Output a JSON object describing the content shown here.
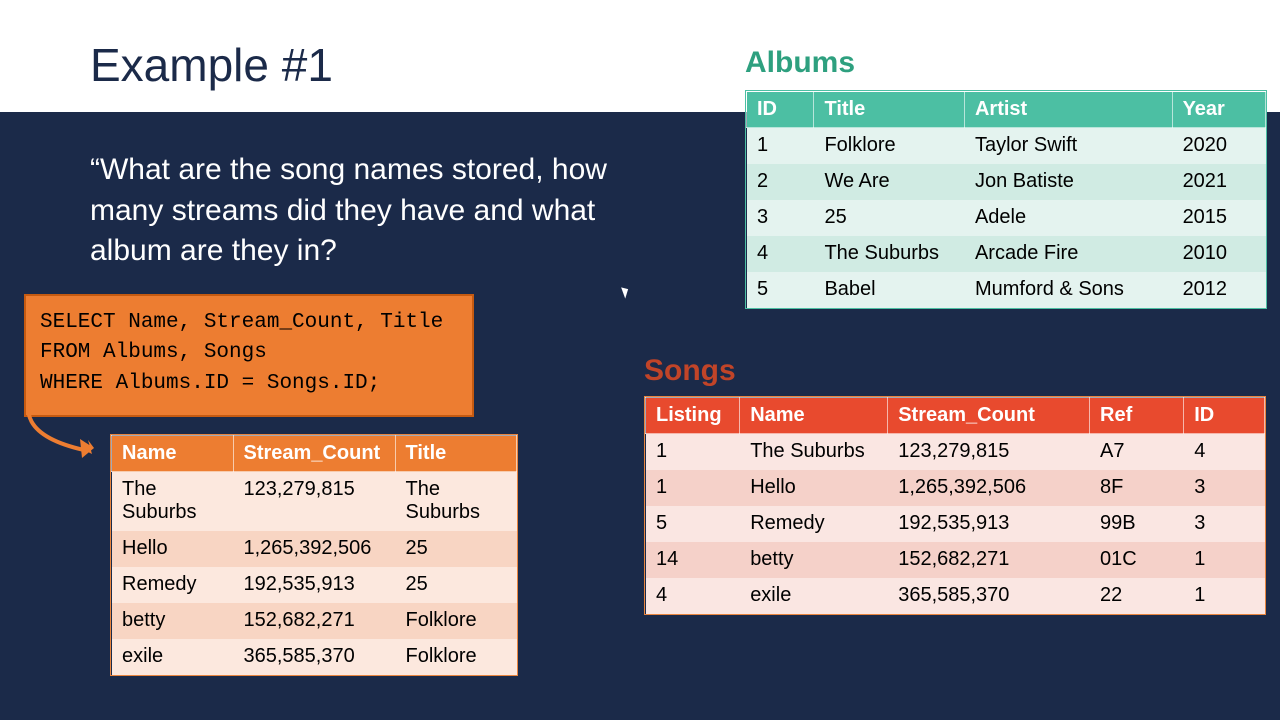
{
  "title": "Example #1",
  "question": "“What are the song names stored, how many streams did they have and what album are they in?",
  "sql": {
    "line1": "SELECT Name, Stream_Count, Title",
    "line2": "FROM Albums, Songs",
    "line3": "WHERE Albums.ID = Songs.ID;"
  },
  "albums": {
    "heading": "Albums",
    "columns": [
      "ID",
      "Title",
      "Artist",
      "Year"
    ],
    "rows": [
      [
        "1",
        "Folklore",
        "Taylor Swift",
        "2020"
      ],
      [
        "2",
        "We Are",
        "Jon Batiste",
        "2021"
      ],
      [
        "3",
        "25",
        "Adele",
        "2015"
      ],
      [
        "4",
        "The Suburbs",
        "Arcade Fire",
        "2010"
      ],
      [
        "5",
        "Babel",
        "Mumford & Sons",
        "2012"
      ]
    ]
  },
  "songs": {
    "heading": "Songs",
    "columns": [
      "Listing",
      "Name",
      "Stream_Count",
      "Ref",
      "ID"
    ],
    "rows": [
      [
        "1",
        "The Suburbs",
        "123,279,815",
        "A7",
        "4"
      ],
      [
        "1",
        "Hello",
        "1,265,392,506",
        "8F",
        "3"
      ],
      [
        "5",
        "Remedy",
        "192,535,913",
        "99B",
        "3"
      ],
      [
        "14",
        "betty",
        "152,682,271",
        "01C",
        "1"
      ],
      [
        "4",
        "exile",
        "365,585,370",
        "22",
        "1"
      ]
    ]
  },
  "result": {
    "columns": [
      "Name",
      "Stream_Count",
      "Title"
    ],
    "rows": [
      [
        "The Suburbs",
        "123,279,815",
        "The Suburbs"
      ],
      [
        "Hello",
        "1,265,392,506",
        "25"
      ],
      [
        "Remedy",
        "192,535,913",
        "25"
      ],
      [
        "betty",
        "152,682,271",
        "Folklore"
      ],
      [
        "exile",
        "365,585,370",
        "Folklore"
      ]
    ]
  }
}
